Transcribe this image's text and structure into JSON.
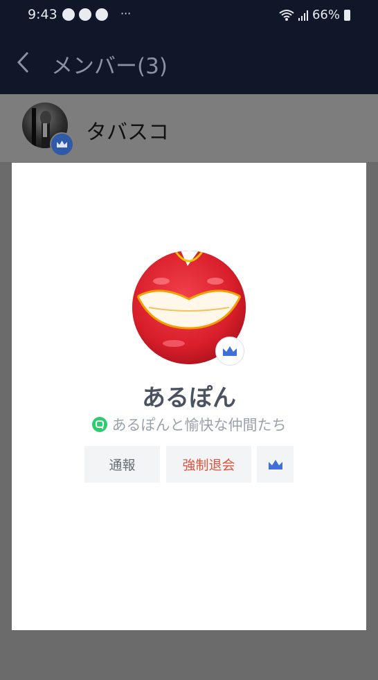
{
  "status_bar": {
    "time": "9:43",
    "more": "···",
    "battery": "66%"
  },
  "header": {
    "title": "メンバー(3)"
  },
  "member": {
    "name": "タバスコ"
  },
  "profile": {
    "name": "あるぽん",
    "group": "あるぽんと愉快な仲間たち"
  },
  "actions": {
    "report": "通報",
    "kick": "強制退会"
  },
  "colors": {
    "header_bg": "#0f1729",
    "crown_blue": "#3f6fd8",
    "kick_red": "#e0533f",
    "openchat_green": "#2ecc71"
  }
}
